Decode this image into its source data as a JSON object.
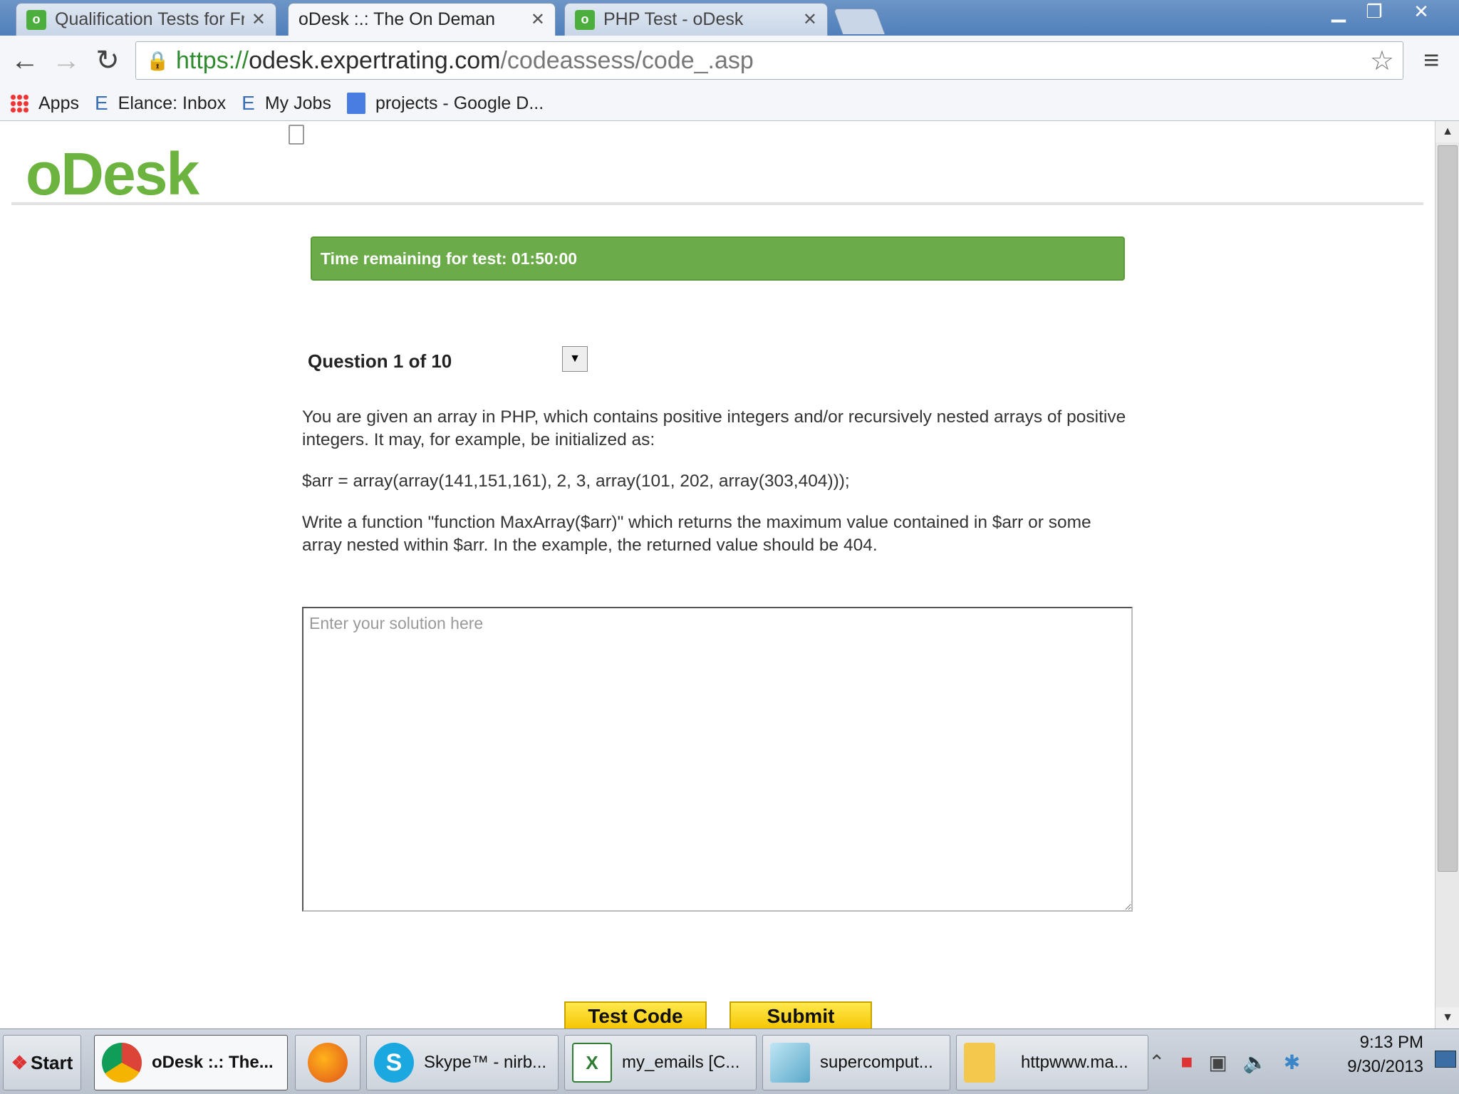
{
  "browser": {
    "tabs": [
      {
        "label": "Qualification Tests for Fre",
        "favicon": "odesk-icon",
        "active": false
      },
      {
        "label": "oDesk :.: The On Deman",
        "favicon": "page-icon",
        "active": true
      },
      {
        "label": "PHP Test - oDesk",
        "favicon": "odesk-icon",
        "active": false
      }
    ],
    "url": {
      "scheme": "https://",
      "host": "odesk.expertrating.com",
      "path": "/codeassess/code_.asp"
    },
    "bookmarks": [
      {
        "label": "Apps",
        "icon": "apps-icon"
      },
      {
        "label": "Elance: Inbox",
        "icon": "elance-icon"
      },
      {
        "label": "My Jobs",
        "icon": "elance-icon"
      },
      {
        "label": "projects - Google D...",
        "icon": "google-doc-icon"
      }
    ]
  },
  "page": {
    "logo": "oDesk",
    "timer_text": "Time remaining for test: 01:50:00",
    "question_label": "Question 1 of 10",
    "question": {
      "p1": "You are given an array in PHP, which contains positive integers and/or recursively nested arrays of positive integers. It may, for example, be initialized as:",
      "p2": "$arr = array(array(141,151,161), 2, 3, array(101, 202, array(303,404)));",
      "p3": "Write a function \"function MaxArray($arr)\" which returns the maximum value contained in $arr or some array nested within $arr. In the example, the returned value should be 404."
    },
    "solution_placeholder": "Enter your solution here",
    "test_code_label": "Test Code",
    "submit_label": "Submit"
  },
  "taskbar": {
    "start_label": "Start",
    "items": [
      {
        "label": "oDesk :.: The...",
        "icon": "chrome-icon",
        "active": true
      },
      {
        "label": "",
        "icon": "firefox-icon",
        "active": false
      },
      {
        "label": "Skype™ - nirb...",
        "icon": "skype-icon",
        "active": false
      },
      {
        "label": "my_emails  [C...",
        "icon": "excel-icon",
        "active": false
      },
      {
        "label": "supercomput...",
        "icon": "notepad-icon",
        "active": false
      },
      {
        "label": "httpwww.ma...",
        "icon": "folder-icon",
        "active": false
      }
    ],
    "clock_time": "9:13 PM",
    "clock_date": "9/30/2013"
  },
  "colors": {
    "odesk_green": "#6cb33f",
    "timer_bg": "#6cab4a",
    "button_yellow": "#f5c400"
  }
}
